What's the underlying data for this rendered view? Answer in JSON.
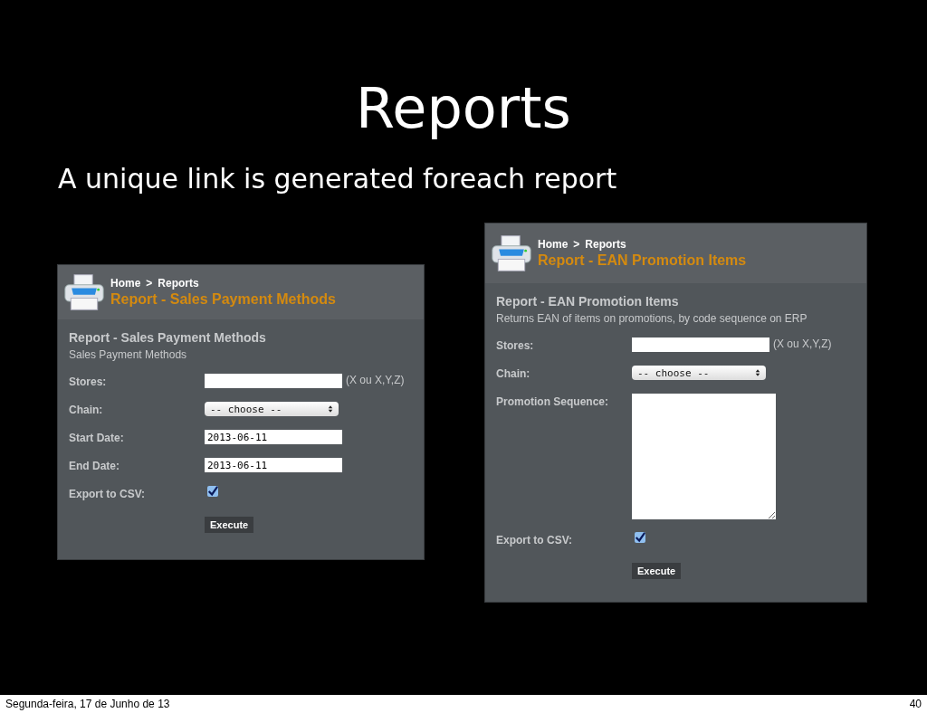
{
  "slide": {
    "title": "Reports",
    "subtitle": "A unique link is generated foreach report",
    "panels": [
      {
        "breadcrumb": {
          "items": [
            "Home",
            "Reports"
          ],
          "separator": ">"
        },
        "page_title": "Report - Sales Payment Methods",
        "form_title": "Report - Sales Payment Methods",
        "form_description": "Sales Payment Methods",
        "fields": [
          {
            "kind": "text",
            "label": "Stores:",
            "hint": "(X ou X,Y,Z)"
          },
          {
            "kind": "select",
            "label": "Chain:",
            "value": "-- choose --"
          },
          {
            "kind": "text",
            "label": "Start Date:",
            "value": "2013-06-11"
          },
          {
            "kind": "text",
            "label": "End Date:",
            "value": "2013-06-11"
          },
          {
            "kind": "checkbox",
            "label": "Export to CSV:",
            "checked": true
          }
        ],
        "button": "Execute"
      },
      {
        "breadcrumb": {
          "items": [
            "Home",
            "Reports"
          ],
          "separator": ">"
        },
        "page_title": "Report - EAN Promotion Items",
        "form_title": "Report - EAN Promotion Items",
        "form_description": "Returns EAN of items on promotions, by code sequence on ERP",
        "fields": [
          {
            "kind": "text",
            "label": "Stores:",
            "hint": "(X ou X,Y,Z)"
          },
          {
            "kind": "select",
            "label": "Chain:",
            "value": "-- choose --"
          },
          {
            "kind": "textarea",
            "label": "Promotion Sequence:"
          },
          {
            "kind": "checkbox",
            "label": "Export to CSV:",
            "checked": true
          }
        ],
        "button": "Execute"
      }
    ]
  },
  "footer": {
    "date": "Segunda-feira, 17 de Junho de 13",
    "page_number": "40"
  }
}
